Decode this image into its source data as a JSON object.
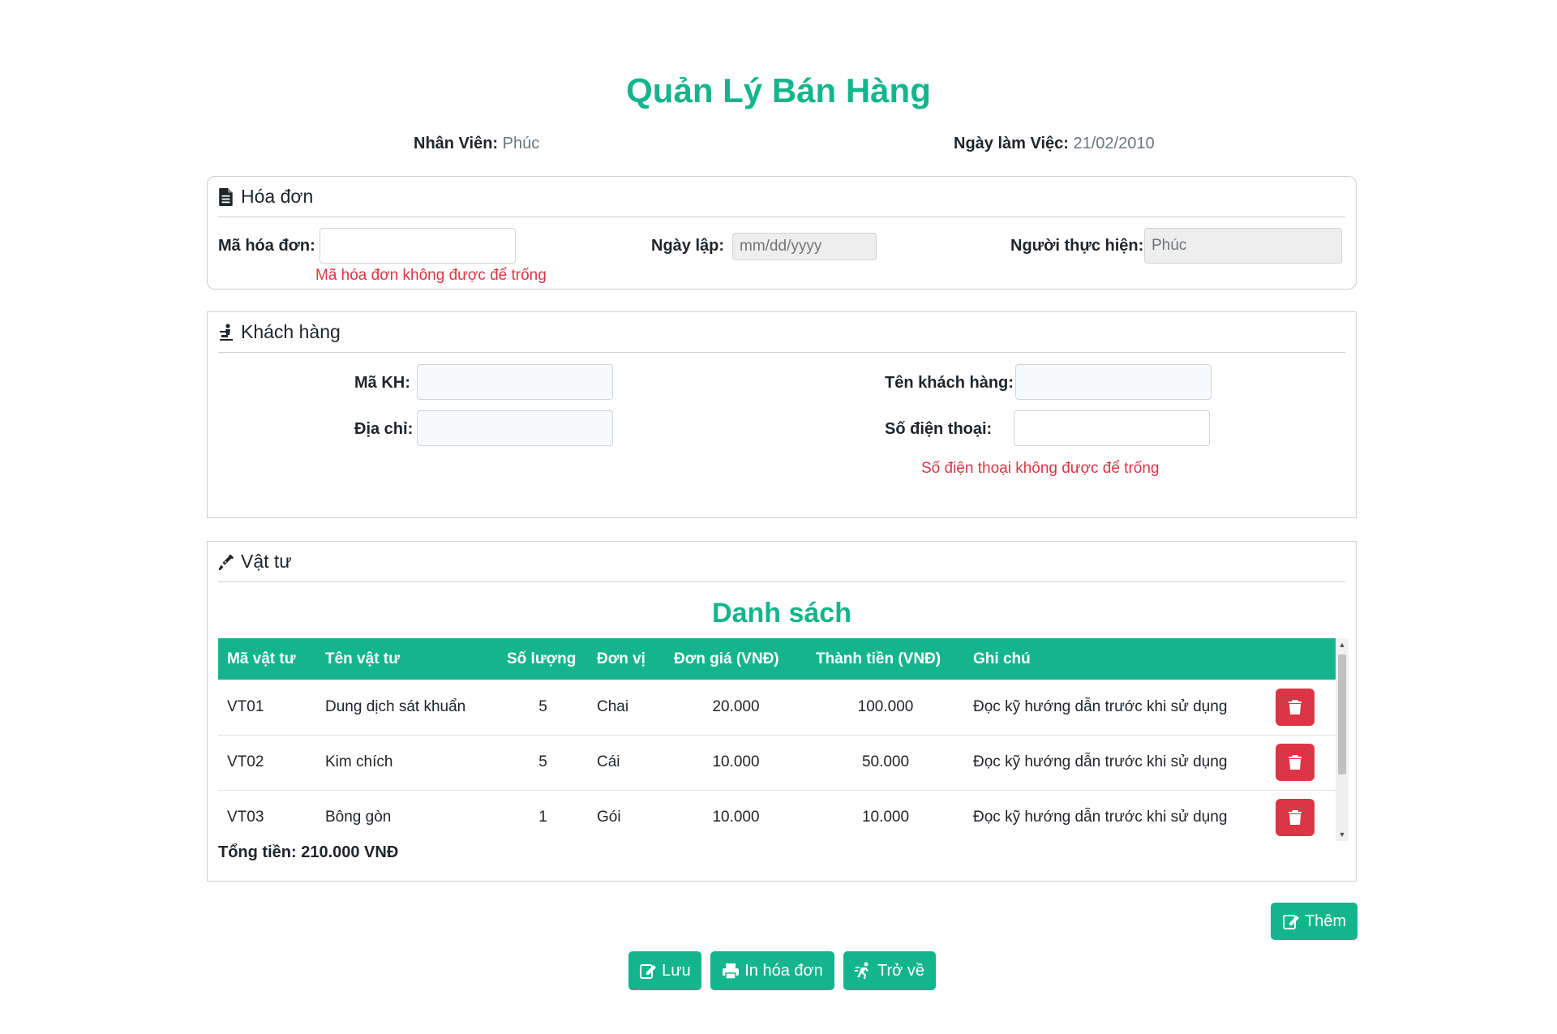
{
  "page": {
    "title": "Quản Lý Bán Hàng"
  },
  "meta": {
    "staff_label": "Nhân Viên:",
    "staff_value": "Phúc",
    "date_label": "Ngày làm Việc:",
    "date_value": "21/02/2010"
  },
  "invoice": {
    "header": "Hóa đơn",
    "code_label": "Mã hóa đơn:",
    "code_value": "",
    "code_error": "Mã hóa đơn không được để trống",
    "date_label": "Ngày lập:",
    "date_placeholder": "mm/dd/yyyy",
    "performer_label": "Người thực hiện:",
    "performer_value": "Phúc"
  },
  "customer": {
    "header": "Khách hàng",
    "id_label": "Mã KH:",
    "id_value": "",
    "name_label": "Tên khách hàng:",
    "name_value": "",
    "address_label": "Địa chỉ:",
    "address_value": "",
    "phone_label": "Số điện thoại:",
    "phone_value": "",
    "phone_error": "Số điện thoại không được để trống"
  },
  "supplies": {
    "header": "Vật tư",
    "list_title": "Danh sách",
    "columns": [
      "Mã vật tư",
      "Tên vật tư",
      "Số lượng",
      "Đơn vị",
      "Đơn giá (VNĐ)",
      "Thành tiền (VNĐ)",
      "Ghi chú"
    ],
    "rows": [
      [
        "VT01",
        "Dung dịch sát khuẩn",
        "5",
        "Chai",
        "20.000",
        "100.000",
        "Đọc kỹ hướng dẫn trước khi sử dụng"
      ],
      [
        "VT02",
        "Kim chích",
        "5",
        "Cái",
        "10.000",
        "50.000",
        "Đọc kỹ hướng dẫn trước khi sử dụng"
      ],
      [
        "VT03",
        "Bông gòn",
        "1",
        "Gói",
        "10.000",
        "10.000",
        "Đọc kỹ hướng dẫn trước khi sử dụng"
      ]
    ],
    "total": "Tổng tiền: 210.000 VNĐ"
  },
  "buttons": {
    "add": "Thêm",
    "save": "Lưu",
    "print": "In hóa đơn",
    "back": "Trở về"
  },
  "colors": {
    "accent": "#14b58d",
    "danger": "#dc3545"
  },
  "icons": {
    "invoice": "file-invoice-icon",
    "customer": "person-carry-icon",
    "supplies": "syringe-icon",
    "delete": "trash-icon",
    "add": "edit-icon",
    "save": "edit-icon",
    "print": "print-icon",
    "back": "running-person-icon"
  }
}
